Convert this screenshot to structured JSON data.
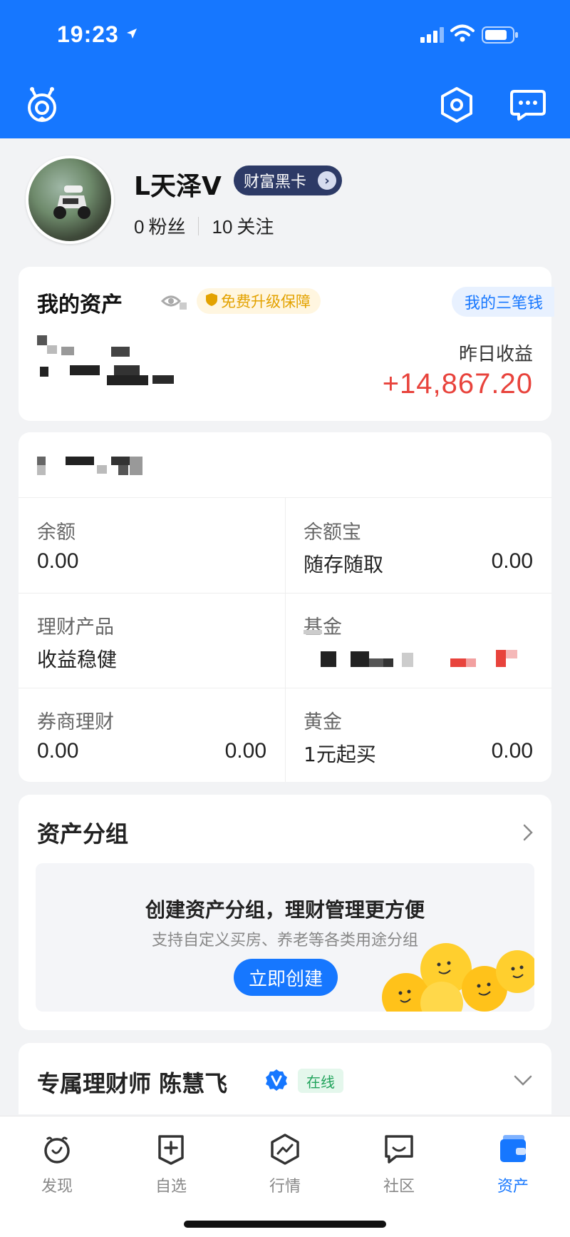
{
  "status_bar": {
    "time": "19:23"
  },
  "header": {
    "logo_icon": "alipay-mascot-icon",
    "settings_icon": "settings-hex-icon",
    "message_icon": "chat-icon",
    "bg_color": "#1677ff"
  },
  "profile": {
    "username": "L天泽V",
    "badge": "财富黑卡",
    "followers_count": "0",
    "followers_label": "粉丝",
    "following_count": "10",
    "following_label": "关注"
  },
  "assets": {
    "title": "我的资产",
    "upgrade_tag": "免费升级保障",
    "three_money": "我的三笔钱",
    "yesterday_label": "昨日收益",
    "yesterday_value": "+14,867.20"
  },
  "accounts": {
    "cells": [
      {
        "label": "余额",
        "sub": "0.00",
        "value": ""
      },
      {
        "label": "余额宝",
        "sub": "随存随取",
        "value": "0.00"
      },
      {
        "label": "理财产品",
        "sub": "收益稳健",
        "value": ""
      },
      {
        "label": "基金",
        "sub": "",
        "value": ""
      },
      {
        "label": "券商理财",
        "sub": "0.00",
        "value": "0.00"
      },
      {
        "label": "黄金",
        "sub": "1元起买",
        "value": "0.00"
      }
    ]
  },
  "asset_group": {
    "title": "资产分组",
    "banner_title": "创建资产分组，理财管理更方便",
    "banner_sub": "支持自定义买房、养老等各类用途分组",
    "create_button": "立即创建"
  },
  "advisor": {
    "name": "专属理财师 陈慧飞",
    "online_tag": "在线"
  },
  "tabbar": {
    "items": [
      {
        "label": "发现",
        "icon": "discover-icon"
      },
      {
        "label": "自选",
        "icon": "watchlist-icon"
      },
      {
        "label": "行情",
        "icon": "market-icon"
      },
      {
        "label": "社区",
        "icon": "community-icon"
      },
      {
        "label": "资产",
        "icon": "assets-wallet-icon"
      }
    ],
    "active_color": "#1677ff"
  }
}
